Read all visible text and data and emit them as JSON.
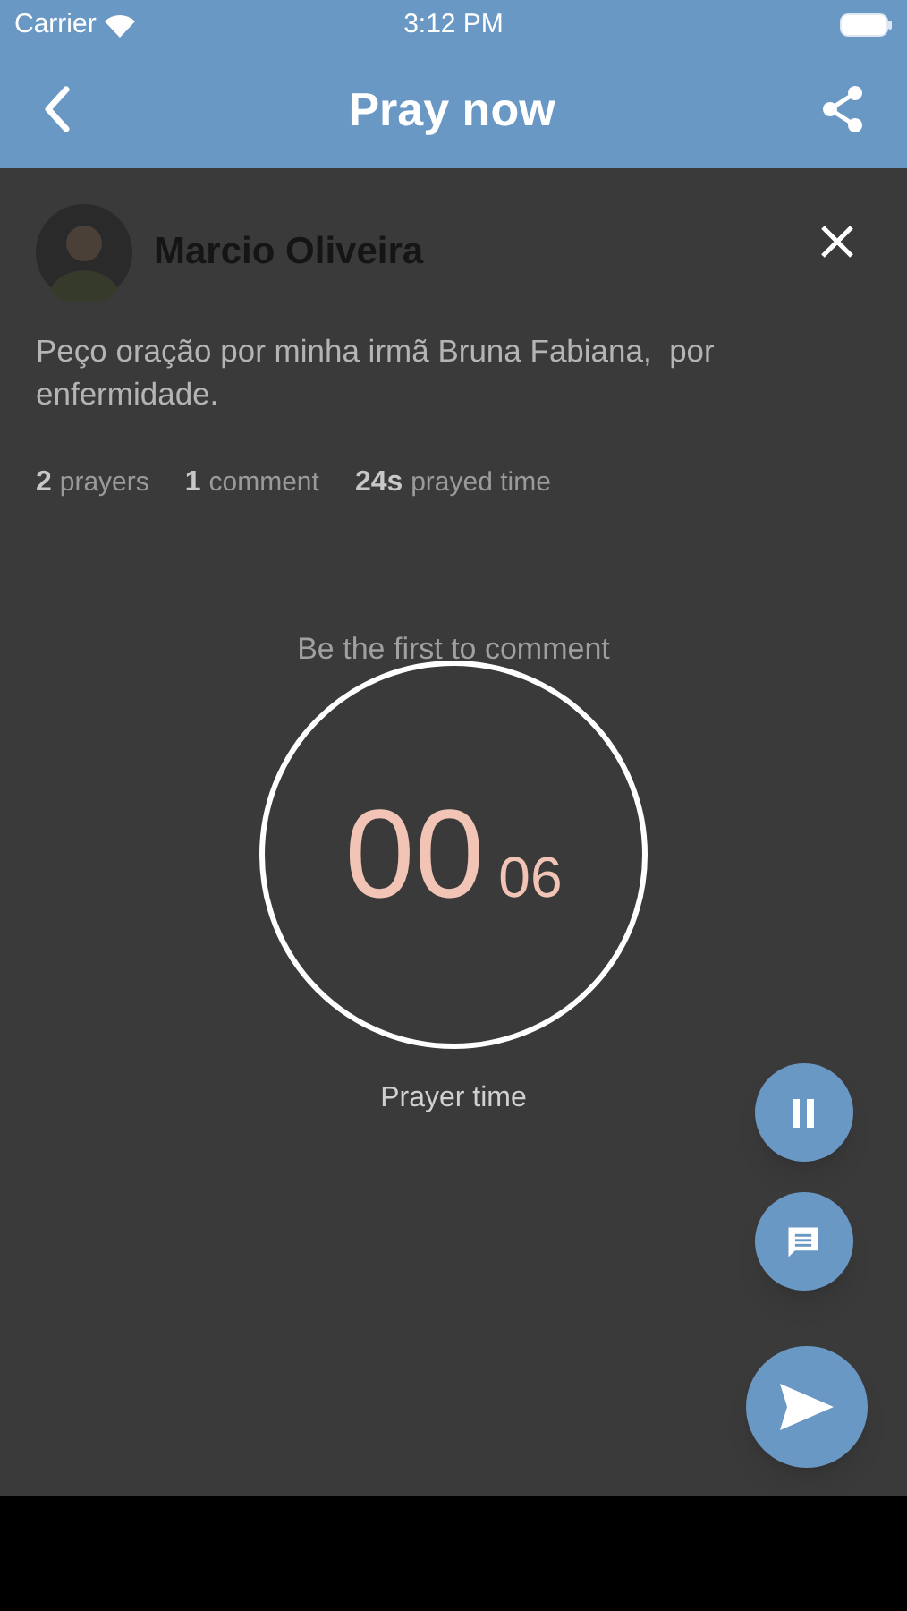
{
  "status_bar": {
    "carrier": "Carrier",
    "time": "3:12 PM"
  },
  "nav": {
    "title": "Pray now"
  },
  "request": {
    "author": "Marcio Oliveira",
    "text": "Peço oração por minha irmã Bruna Fabiana,  por enfermidade.",
    "stats": [
      {
        "count": "2",
        "unit": "prayers"
      },
      {
        "count": "1",
        "unit": "comment"
      },
      {
        "count": "24s",
        "unit": "prayed time"
      }
    ]
  },
  "comments": {
    "empty_message": "Be the first to comment"
  },
  "timer": {
    "minutes": "00",
    "seconds": "06",
    "caption": "Prayer time",
    "paused": false
  },
  "actions": [
    {
      "kind": "pause"
    },
    {
      "kind": "comment"
    },
    {
      "kind": "send"
    }
  ]
}
